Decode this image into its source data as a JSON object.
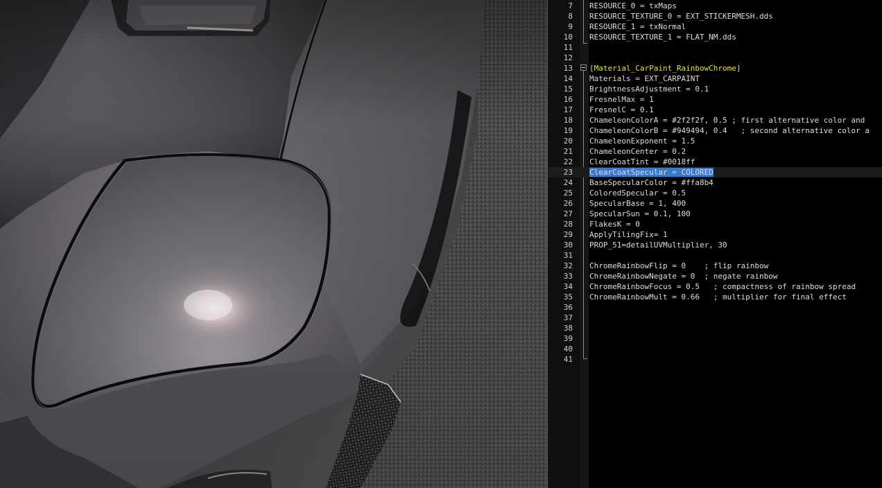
{
  "viewport": {
    "description_name": "car-render-viewport"
  },
  "editor": {
    "lines": [
      {
        "n": "7",
        "text": "RESOURCE_0 = txMaps"
      },
      {
        "n": "8",
        "text": "RESOURCE_TEXTURE_0 = EXT_STICKERMESH.dds"
      },
      {
        "n": "9",
        "text": "RESOURCE_1 = txNormal"
      },
      {
        "n": "10",
        "text": "RESOURCE_TEXTURE_1 = FLAT_NM.dds"
      },
      {
        "n": "11",
        "text": ""
      },
      {
        "n": "12",
        "text": ""
      },
      {
        "n": "13",
        "text": "[Material_CarPaint_RainbowChrome]"
      },
      {
        "n": "14",
        "text": "Materials = EXT_CARPAINT"
      },
      {
        "n": "15",
        "text": "BrightnessAdjustment = 0.1"
      },
      {
        "n": "16",
        "text": "FresnelMax = 1"
      },
      {
        "n": "17",
        "text": "FresnelC = 0.1"
      },
      {
        "n": "18",
        "text": "ChameleonColorA = #2f2f2f, 0.5 ; first alternative color and"
      },
      {
        "n": "19",
        "text": "ChameleonColorB = #949494, 0.4   ; second alternative color a"
      },
      {
        "n": "20",
        "text": "ChameleonExponent = 1.5"
      },
      {
        "n": "21",
        "text": "ChameleonCenter = 0.2"
      },
      {
        "n": "22",
        "text": "ClearCoatTint = #0018ff"
      },
      {
        "n": "23",
        "text": "ClearCoatSpecular = COLORED"
      },
      {
        "n": "24",
        "text": "BaseSpecularColor = #ffa8b4"
      },
      {
        "n": "25",
        "text": "ColoredSpecular = 0.5"
      },
      {
        "n": "26",
        "text": "SpecularBase = 1, 400"
      },
      {
        "n": "27",
        "text": "SpecularSun = 0.1, 100"
      },
      {
        "n": "28",
        "text": "FlakesK = 0"
      },
      {
        "n": "29",
        "text": "ApplyTilingFix= 1"
      },
      {
        "n": "30",
        "text": "PROP_51=detailUVMultiplier, 30"
      },
      {
        "n": "31",
        "text": ""
      },
      {
        "n": "32",
        "text": "ChromeRainbowFlip = 0    ; flip rainbow"
      },
      {
        "n": "33",
        "text": "ChromeRainbowNegate = 0  ; negate rainbow"
      },
      {
        "n": "34",
        "text": "ChromeRainbowFocus = 0.5   ; compactness of rainbow spread"
      },
      {
        "n": "35",
        "text": "ChromeRainbowMult = 0.66   ; multiplier for final effect"
      },
      {
        "n": "36",
        "text": ""
      },
      {
        "n": "37",
        "text": ""
      },
      {
        "n": "38",
        "text": ""
      },
      {
        "n": "39",
        "text": ""
      },
      {
        "n": "40",
        "text": ""
      },
      {
        "n": "41",
        "text": ""
      }
    ],
    "section_line": "13",
    "current_line": "23"
  },
  "colors": {
    "section_header": "#e8e23a",
    "selection": "#3c78c8",
    "code_text": "#dedede"
  }
}
